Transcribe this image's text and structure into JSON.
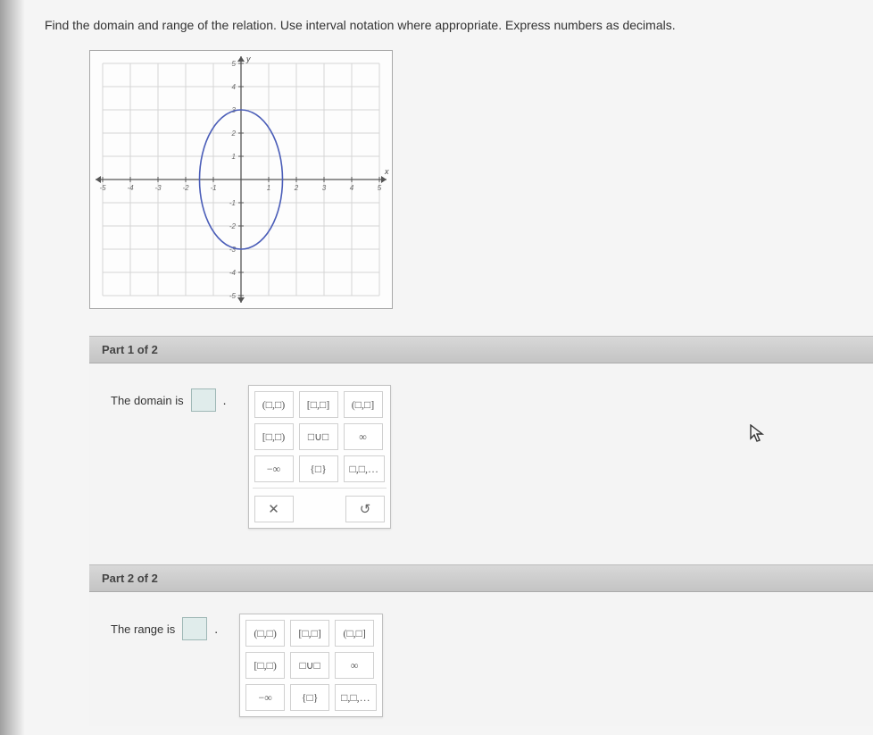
{
  "question": "Find the domain and range of the relation. Use interval notation where appropriate. Express numbers as decimals.",
  "chart_data": {
    "type": "scatter",
    "title": "",
    "xlabel": "x",
    "ylabel": "y",
    "xlim": [
      -5,
      5
    ],
    "ylim": [
      -5,
      5
    ],
    "x_ticks": [
      -5,
      -4,
      -3,
      -2,
      -1,
      0,
      1,
      2,
      3,
      4,
      5
    ],
    "y_ticks": [
      -5,
      -4,
      -3,
      -2,
      -1,
      0,
      1,
      2,
      3,
      4,
      5
    ],
    "grid": true,
    "shape": {
      "kind": "ellipse",
      "cx": 0,
      "cy": 0,
      "rx": 1.5,
      "ry": 3,
      "stroke": "#4a5db8",
      "fill": "none"
    }
  },
  "parts": [
    {
      "header": "Part 1 of 2",
      "prompt": "The domain is",
      "value": ""
    },
    {
      "header": "Part 2 of 2",
      "prompt": "The range is",
      "value": ""
    }
  ],
  "palette": {
    "row1": [
      "(□,□)",
      "[□,□]",
      "(□,□]"
    ],
    "row2": [
      "[□,□)",
      "□∪□",
      "∞"
    ],
    "row3": [
      "−∞",
      "{□}",
      "□,□,…"
    ],
    "tools": {
      "clear": "✕",
      "undo": "↺"
    }
  }
}
